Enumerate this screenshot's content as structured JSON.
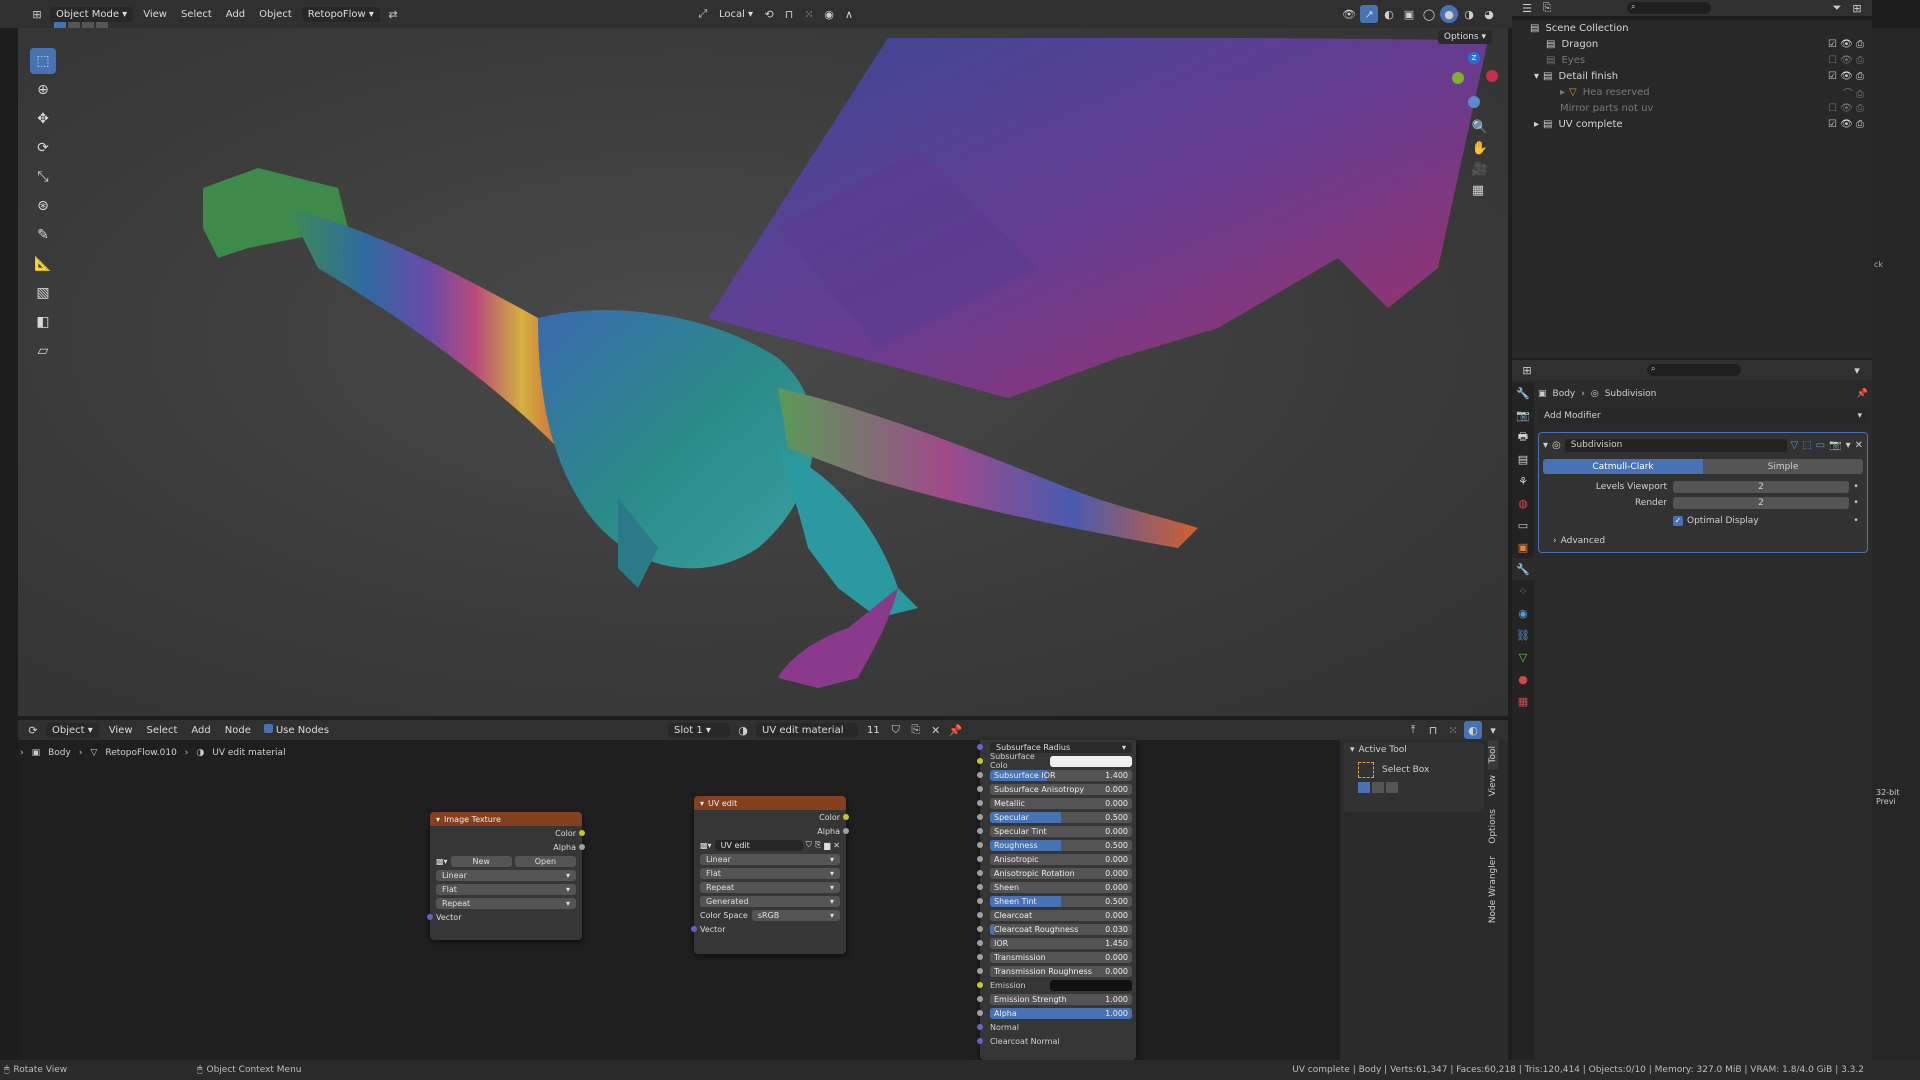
{
  "top_header": {
    "mode": "Object Mode",
    "menus": [
      "View",
      "Select",
      "Add",
      "Object"
    ],
    "addon": "RetopoFlow",
    "transform_orientation": "Local",
    "options_label": "Options"
  },
  "tools": [
    "select-box",
    "cursor",
    "move",
    "rotate",
    "scale",
    "transform",
    "annotate",
    "measure",
    "add-cube",
    "extrude",
    "shear"
  ],
  "outliner": {
    "root": "Scene Collection",
    "items": [
      {
        "name": "Dragon",
        "visible": true
      },
      {
        "name": "Eyes",
        "visible": false
      },
      {
        "name": "Detail finish",
        "visible": true
      },
      {
        "name": "Hea reserved",
        "visible": false
      },
      {
        "name": "Mirror parts not uv",
        "visible": false
      },
      {
        "name": "UV complete",
        "visible": true
      }
    ]
  },
  "properties": {
    "breadcrumb_object": "Body",
    "breadcrumb_modifier": "Subdivision",
    "add_modifier": "Add Modifier",
    "modifier_name": "Subdivision",
    "mode_catmull": "Catmull-Clark",
    "mode_simple": "Simple",
    "levels_viewport_label": "Levels Viewport",
    "levels_viewport": "2",
    "render_label": "Render",
    "render": "2",
    "optimal_display": "Optimal Display",
    "advanced": "Advanced"
  },
  "node_editor": {
    "header": {
      "editor_type": "Object",
      "menus": [
        "View",
        "Select",
        "Add",
        "Node"
      ],
      "use_nodes": "Use Nodes",
      "slot": "Slot 1",
      "material": "UV edit material",
      "user_count": "11"
    },
    "breadcrumb": {
      "object": "Body",
      "mesh": "RetopoFlow.010",
      "material": "UV edit material"
    },
    "image_texture_node": {
      "title": "Image Texture",
      "out_color": "Color",
      "out_alpha": "Alpha",
      "new": "New",
      "open": "Open",
      "interpolation": "Linear",
      "projection": "Flat",
      "extension": "Repeat",
      "in_vector": "Vector"
    },
    "uv_edit_node": {
      "title": "UV edit",
      "out_color": "Color",
      "out_alpha": "Alpha",
      "image_name": "UV edit",
      "interpolation": "Linear",
      "projection": "Flat",
      "extension": "Repeat",
      "source": "Generated",
      "color_space_label": "Color Space",
      "color_space": "sRGB",
      "in_vector": "Vector"
    },
    "bsdf": {
      "subsurface_radius": "Subsurface Radius",
      "subsurface_color": "Subsurface Colo",
      "rows": [
        {
          "label": "Subsurface IOR",
          "value": "1.400",
          "fill": 0.4
        },
        {
          "label": "Subsurface Anisotropy",
          "value": "0.000",
          "fill": 0
        },
        {
          "label": "Metallic",
          "value": "0.000",
          "fill": 0
        },
        {
          "label": "Specular",
          "value": "0.500",
          "fill": 0.5
        },
        {
          "label": "Specular Tint",
          "value": "0.000",
          "fill": 0
        },
        {
          "label": "Roughness",
          "value": "0.500",
          "fill": 0.5
        },
        {
          "label": "Anisotropic",
          "value": "0.000",
          "fill": 0
        },
        {
          "label": "Anisotropic Rotation",
          "value": "0.000",
          "fill": 0
        },
        {
          "label": "Sheen",
          "value": "0.000",
          "fill": 0
        },
        {
          "label": "Sheen Tint",
          "value": "0.500",
          "fill": 0.5
        },
        {
          "label": "Clearcoat",
          "value": "0.000",
          "fill": 0
        },
        {
          "label": "Clearcoat Roughness",
          "value": "0.030",
          "fill": 0.03
        },
        {
          "label": "IOR",
          "value": "1.450",
          "fill": 0
        },
        {
          "label": "Transmission",
          "value": "0.000",
          "fill": 0
        },
        {
          "label": "Transmission Roughness",
          "value": "0.000",
          "fill": 0
        }
      ],
      "emission": "Emission",
      "rows2": [
        {
          "label": "Emission Strength",
          "value": "1.000",
          "fill": 0
        },
        {
          "label": "Alpha",
          "value": "1.000",
          "fill": 1
        }
      ],
      "normal": "Normal",
      "clearcoat_normal": "Clearcoat Normal"
    },
    "side_panel": {
      "active_tool": "Active Tool",
      "select_box": "Select Box",
      "tabs": [
        "Tool",
        "View",
        "Options",
        "Node Wrangler"
      ]
    }
  },
  "status_bar": {
    "left": "Rotate View",
    "middle": "Object Context Menu",
    "right": "UV complete | Body | Verts:61,347 | Faces:60,218 | Tris:120,414 | Objects:0/10 | Memory: 327.0 MiB | VRAM: 1.8/4.0 GiB | 3.3.2"
  },
  "far_right": {
    "label": "32-bit Previ",
    "partial": "ck"
  },
  "colors": {
    "accent": "#4772b3",
    "texture_header": "#843f1f",
    "panel": "#2b2b2b"
  }
}
